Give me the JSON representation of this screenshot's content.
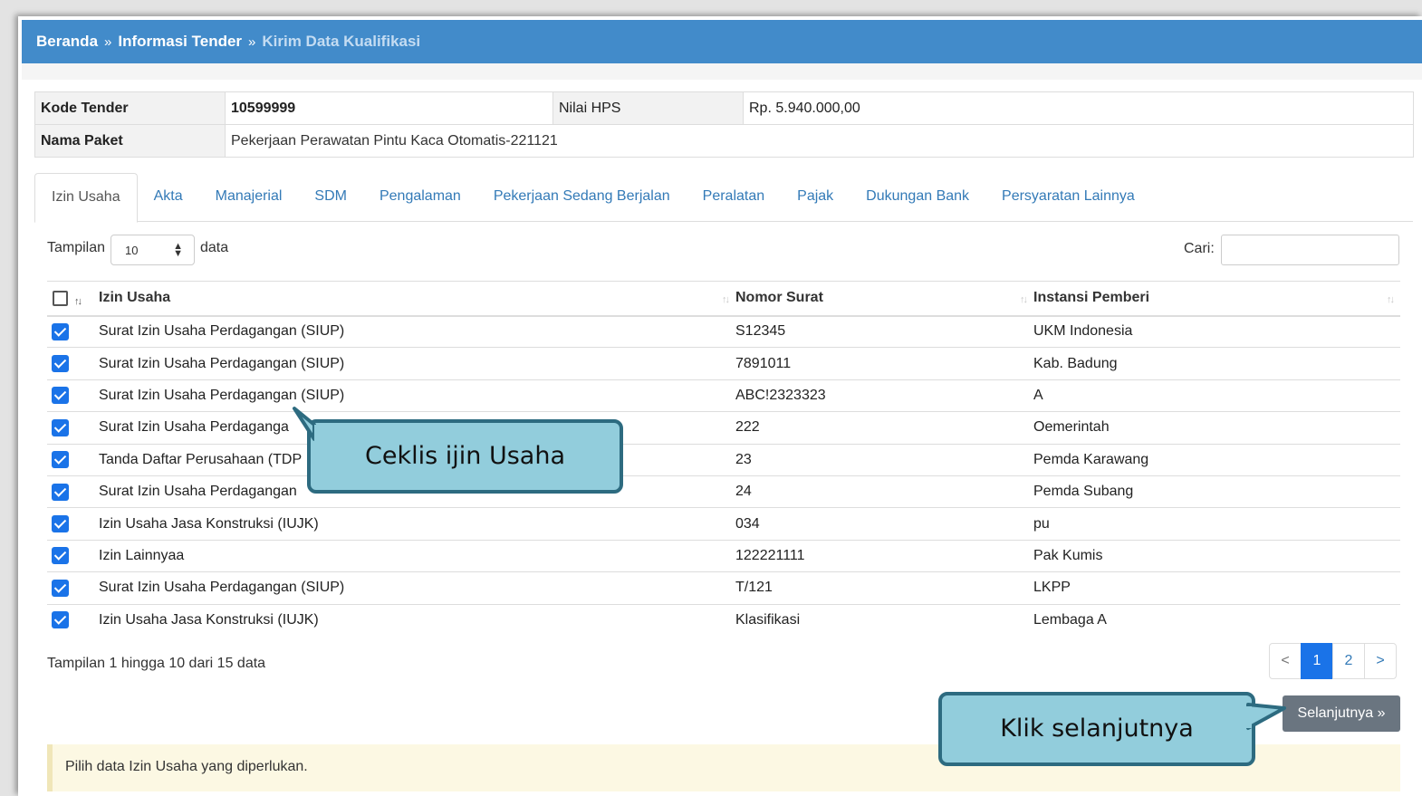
{
  "breadcrumb": {
    "home": "Beranda",
    "sep": "»",
    "info": "Informasi Tender",
    "current": "Kirim Data Kualifikasi"
  },
  "tender": {
    "kode_label": "Kode Tender",
    "kode_value": "10599999",
    "hps_label": "Nilai HPS",
    "hps_value": "Rp. 5.940.000,00",
    "nama_label": "Nama Paket",
    "nama_value": "Pekerjaan Perawatan Pintu Kaca Otomatis-221121"
  },
  "tabs": [
    "Izin Usaha",
    "Akta",
    "Manajerial",
    "SDM",
    "Pengalaman",
    "Pekerjaan Sedang Berjalan",
    "Peralatan",
    "Pajak",
    "Dukungan Bank",
    "Persyaratan Lainnya"
  ],
  "controls": {
    "length_prefix": "Tampilan",
    "length_value": "10",
    "length_suffix": "data",
    "search_label": "Cari:",
    "search_value": ""
  },
  "table": {
    "headers": [
      "Izin Usaha",
      "Nomor Surat",
      "Instansi Pemberi"
    ],
    "rows": [
      {
        "checked": true,
        "izin": "Surat Izin Usaha Perdagangan (SIUP)",
        "nomor": "S12345",
        "instansi": "UKM Indonesia"
      },
      {
        "checked": true,
        "izin": "Surat Izin Usaha Perdagangan (SIUP)",
        "nomor": "7891011",
        "instansi": "Kab. Badung"
      },
      {
        "checked": true,
        "izin": "Surat Izin Usaha Perdagangan (SIUP)",
        "nomor": "ABC!2323323",
        "instansi": "A"
      },
      {
        "checked": true,
        "izin": "Surat Izin Usaha Perdaganga",
        "nomor": "222",
        "instansi": "Oemerintah"
      },
      {
        "checked": true,
        "izin": "Tanda Daftar Perusahaan (TDP",
        "nomor": "23",
        "instansi": "Pemda Karawang"
      },
      {
        "checked": true,
        "izin": "Surat Izin Usaha Perdagangan",
        "nomor": "24",
        "instansi": "Pemda Subang"
      },
      {
        "checked": true,
        "izin": "Izin Usaha Jasa Konstruksi (IUJK)",
        "nomor": "034",
        "instansi": "pu"
      },
      {
        "checked": true,
        "izin": "Izin Lainnyaa",
        "nomor": "122221111",
        "instansi": "Pak Kumis"
      },
      {
        "checked": true,
        "izin": "Surat Izin Usaha Perdagangan (SIUP)",
        "nomor": "T/121",
        "instansi": "LKPP"
      },
      {
        "checked": true,
        "izin": "Izin Usaha Jasa Konstruksi (IUJK)",
        "nomor": "Klasifikasi",
        "instansi": "Lembaga A"
      }
    ]
  },
  "footer": {
    "info": "Tampilan 1 hingga 10 dari 15 data",
    "pages": [
      "<",
      "1",
      "2",
      ">"
    ],
    "active_page": "1",
    "next_label": "Selanjutnya »"
  },
  "alert": {
    "text": "Pilih data Izin Usaha yang diperlukan."
  },
  "callouts": {
    "check": "Ceklis ijin Usaha",
    "next": "Klik selanjutnya"
  },
  "colors": {
    "header_blue": "#428bca",
    "checkbox_blue": "#1a73e8",
    "callout_fill": "#92cddc",
    "callout_border": "#2d6b80",
    "alert_bg": "#fcf8e3"
  }
}
